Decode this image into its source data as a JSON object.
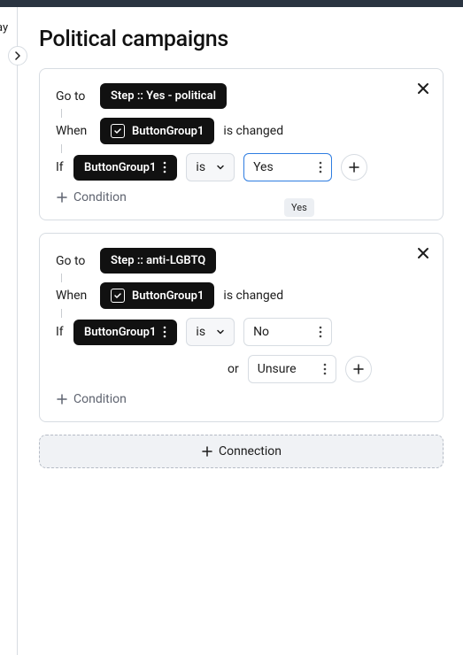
{
  "edge": {
    "clipped_label": "ay"
  },
  "page": {
    "title": "Political campaigns"
  },
  "rules": [
    {
      "goto_label": "Go to",
      "goto_value": "Step :: Yes - political",
      "when_label": "When",
      "when_value": "ButtonGroup1",
      "when_suffix": "is changed",
      "if_label": "If",
      "if_subject": "ButtonGroup1",
      "if_op": "is",
      "if_value": "Yes",
      "if_value_active": true,
      "condition_label": "Condition",
      "tooltip": "Yes"
    },
    {
      "goto_label": "Go to",
      "goto_value": "Step :: anti-LGBTQ",
      "when_label": "When",
      "when_value": "ButtonGroup1",
      "when_suffix": "is changed",
      "if_label": "If",
      "if_subject": "ButtonGroup1",
      "if_op": "is",
      "if_value": "No",
      "or_label": "or",
      "or_value": "Unsure",
      "condition_label": "Condition"
    }
  ],
  "connection_label": "Connection"
}
